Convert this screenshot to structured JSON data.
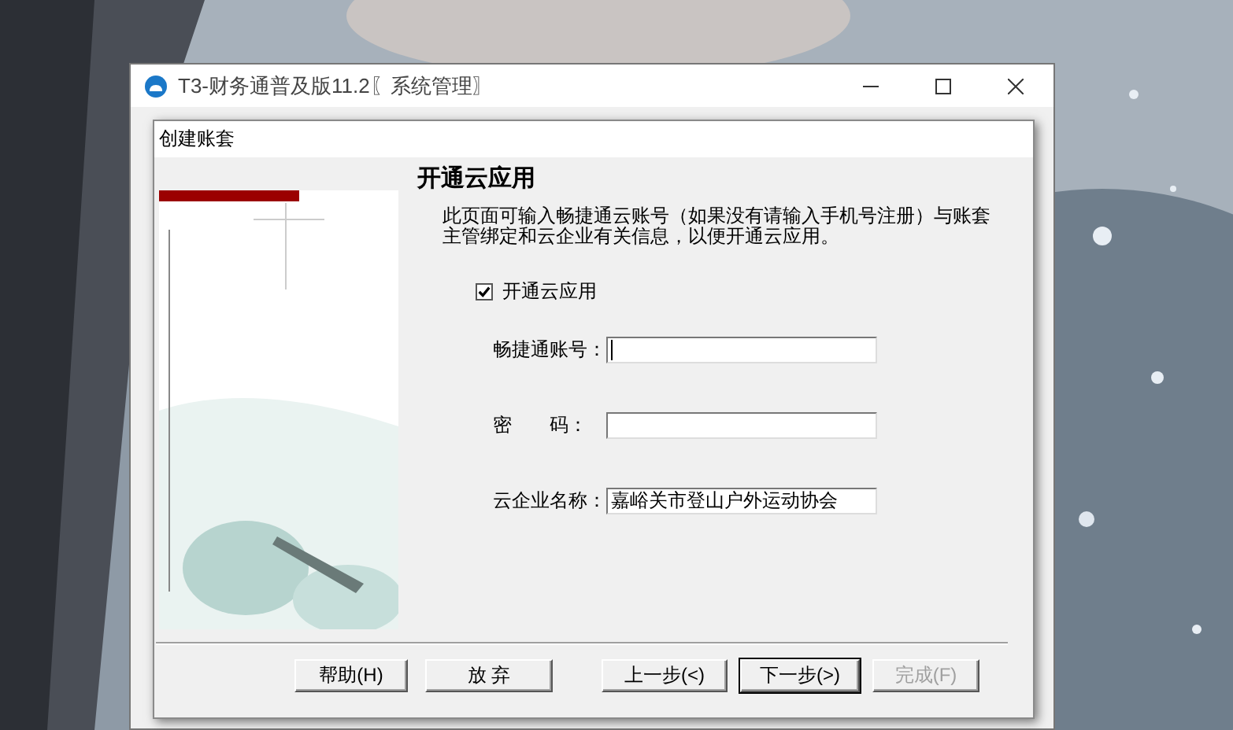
{
  "main_window": {
    "title": "T3-财务通普及版11.2〖系统管理〗"
  },
  "dialog": {
    "title": "创建账套",
    "heading": "开通云应用",
    "description": "此页面可输入畅捷通云账号（如果没有请输入手机号注册）与账套主管绑定和云企业有关信息，以便开通云应用。",
    "enable_cloud": {
      "label": "开通云应用",
      "checked": true
    },
    "fields": [
      {
        "label": "畅捷通账号：",
        "focused": true
      },
      {
        "label": "密　　码：",
        "focused": false
      },
      {
        "label": "云企业名称：",
        "value": "嘉峪关市登山户外运动协会",
        "focused": false
      }
    ],
    "buttons": [
      {
        "label": "帮助(H)",
        "default": false,
        "disabled": false
      },
      {
        "label": "放 弃",
        "default": false,
        "disabled": false
      },
      {
        "label": "上一步(<)",
        "default": false,
        "disabled": false
      },
      {
        "label": "下一步(>)",
        "default": true,
        "disabled": false
      },
      {
        "label": "完成(F)",
        "default": false,
        "disabled": true
      }
    ]
  }
}
